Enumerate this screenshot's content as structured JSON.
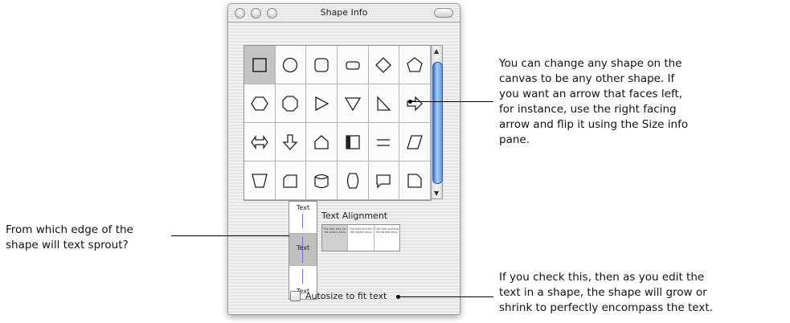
{
  "window": {
    "title": "Shape Info"
  },
  "shapes": [
    "square",
    "circle",
    "rounded-square",
    "rounded-rect",
    "diamond",
    "pentagon",
    "hexagon",
    "octagon",
    "triangle-right",
    "triangle-down",
    "right-triangle",
    "arrow-right",
    "arrow-double",
    "arrow-down",
    "house",
    "frame",
    "equals",
    "parallelogram",
    "trapezoid",
    "slanted-card",
    "cylinder",
    "rounded-hexagon",
    "speech-box",
    "folded-page"
  ],
  "text_alignment": {
    "label": "Text Alignment",
    "vertical_labels": [
      "Text",
      "Text",
      "Text"
    ],
    "horizontal_samples": [
      "The text and the file where joins",
      "The text and the file where joins",
      "The text and the file where joins"
    ]
  },
  "autosize": {
    "label": "Autosize to fit text"
  },
  "annotations": {
    "shapes_note": [
      "You can change any shape on the",
      "canvas to be any other shape. If",
      "you want an arrow that faces left,",
      "for instance, use the right facing",
      "arrow and flip it using the Size info",
      "pane."
    ],
    "edge_note": [
      "From which edge of the",
      "shape will text sprout?"
    ],
    "autosize_note": [
      "If you check this, then as you edit the",
      "text in a shape, the shape will grow or",
      "shrink to perfectly encompass the text."
    ]
  }
}
